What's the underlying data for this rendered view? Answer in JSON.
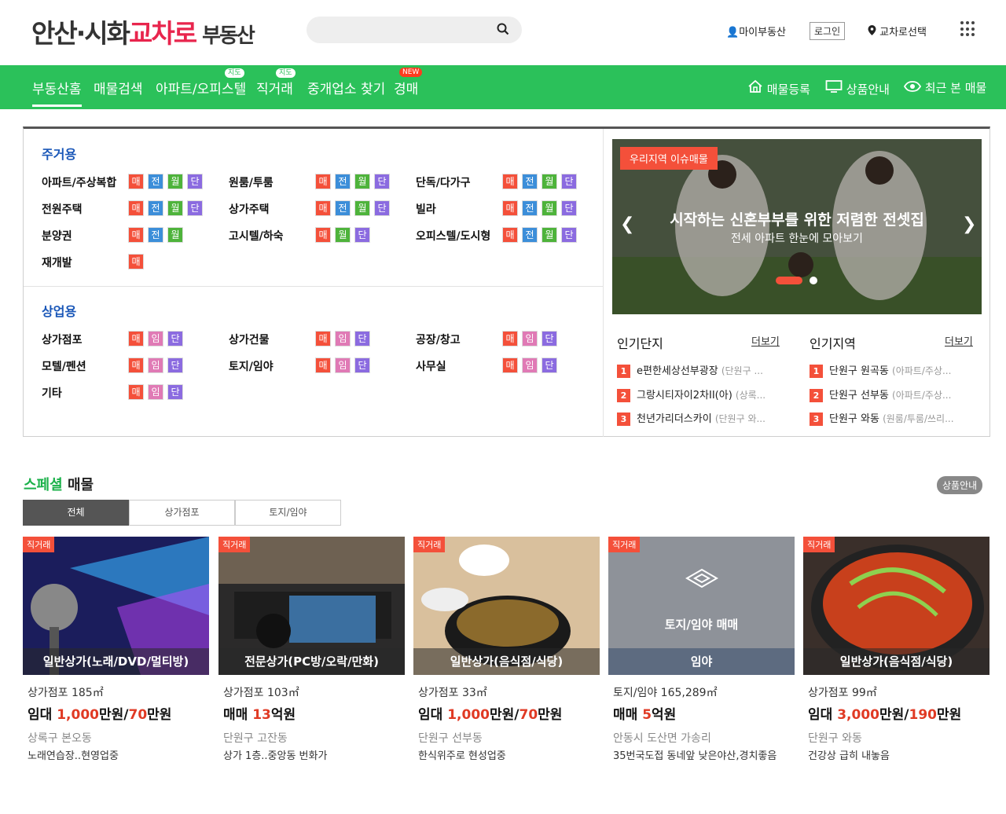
{
  "header": {
    "logo": {
      "part1": "안산·시화",
      "part2": "교차로",
      "part3": "부동산"
    },
    "my_link": "마이부동산",
    "login": "로그인",
    "region_select": "교차로선택"
  },
  "nav": {
    "items": [
      {
        "label": "부동산홈"
      },
      {
        "label": "매물검색"
      },
      {
        "label": "아파트/오피스텔",
        "tag": "지도"
      },
      {
        "label": "직거래",
        "tag": "지도"
      },
      {
        "label": "중개업소 찾기"
      },
      {
        "label": "경매",
        "tag": "NEW"
      }
    ],
    "right": [
      "매물등록",
      "상품안내",
      "최근 본 매물"
    ]
  },
  "categories": {
    "residential_title": "주거용",
    "residential": [
      {
        "name": "아파트/주상복합",
        "tags": [
          "매",
          "전",
          "월",
          "단"
        ]
      },
      {
        "name": "원룸/투룸",
        "tags": [
          "매",
          "전",
          "월",
          "단"
        ]
      },
      {
        "name": "단독/다가구",
        "tags": [
          "매",
          "전",
          "월",
          "단"
        ]
      },
      {
        "name": "전원주택",
        "tags": [
          "매",
          "전",
          "월",
          "단"
        ]
      },
      {
        "name": "상가주택",
        "tags": [
          "매",
          "전",
          "월",
          "단"
        ]
      },
      {
        "name": "빌라",
        "tags": [
          "매",
          "전",
          "월",
          "단"
        ]
      },
      {
        "name": "분양권",
        "tags": [
          "매",
          "전",
          "월"
        ]
      },
      {
        "name": "고시텔/하숙",
        "tags": [
          "매",
          "월",
          "단"
        ]
      },
      {
        "name": "오피스텔/도시형",
        "tags": [
          "매",
          "전",
          "월",
          "단"
        ]
      },
      {
        "name": "재개발",
        "tags": [
          "매"
        ]
      }
    ],
    "commercial_title": "상업용",
    "commercial": [
      {
        "name": "상가점포",
        "tags": [
          "매",
          "임",
          "단"
        ]
      },
      {
        "name": "상가건물",
        "tags": [
          "매",
          "임",
          "단"
        ]
      },
      {
        "name": "공장/창고",
        "tags": [
          "매",
          "임",
          "단"
        ]
      },
      {
        "name": "모텔/펜션",
        "tags": [
          "매",
          "임",
          "단"
        ]
      },
      {
        "name": "토지/임야",
        "tags": [
          "매",
          "임",
          "단"
        ]
      },
      {
        "name": "사무실",
        "tags": [
          "매",
          "임",
          "단"
        ]
      },
      {
        "name": "기타",
        "tags": [
          "매",
          "임",
          "단"
        ]
      }
    ]
  },
  "banner": {
    "tag": "우리지역 이슈매물",
    "title": "시작하는 신혼부부를 위한 저렴한 전셋집",
    "subtitle": "전세 아파트 한눈에 모아보기"
  },
  "rankings": {
    "complex_title": "인기단지",
    "region_title": "인기지역",
    "more": "더보기",
    "complex": [
      {
        "rank": "1",
        "name": "e편한세상선부광장",
        "sub": "(단원구 ..."
      },
      {
        "rank": "2",
        "name": "그랑시티자이2차II(아)",
        "sub": "(상록..."
      },
      {
        "rank": "3",
        "name": "천년가리더스카이",
        "sub": "(단원구 와..."
      }
    ],
    "region": [
      {
        "rank": "1",
        "name": "단원구 원곡동",
        "sub": "(아파트/주상..."
      },
      {
        "rank": "2",
        "name": "단원구 선부동",
        "sub": "(아파트/주상..."
      },
      {
        "rank": "3",
        "name": "단원구 와동",
        "sub": "(원룸/투룸/쓰리..."
      }
    ]
  },
  "special": {
    "title_green": "스페셜",
    "title_rest": "매물",
    "guide_btn": "상품안내",
    "tabs": [
      "전체",
      "상가점포",
      "토지/임야"
    ],
    "cards": [
      {
        "badge": "직거래",
        "caption": "일반상가(노래/DVD/멀티방)",
        "line1": "상가점포 185㎡",
        "price_pre": "임대 ",
        "p1": "1,000",
        "p1u": "만원/",
        "p2": "70",
        "p2u": "만원",
        "location": "상록구 본오동",
        "desc": "노래연습장..현영업중"
      },
      {
        "badge": "직거래",
        "caption": "전문상가(PC방/오락/만화)",
        "line1": "상가점포 103㎡",
        "price_pre": "매매 ",
        "p1": "13",
        "p1u": "억원",
        "p2": "",
        "p2u": "",
        "location": "단원구 고잔동",
        "desc": "상가 1층..중앙동 번화가"
      },
      {
        "badge": "직거래",
        "caption": "일반상가(음식점/식당)",
        "line1": "상가점포 33㎡",
        "price_pre": "임대 ",
        "p1": "1,000",
        "p1u": "만원/",
        "p2": "70",
        "p2u": "만원",
        "location": "단원구 선부동",
        "desc": "한식위주로 현성업중"
      },
      {
        "badge": "직거래",
        "caption": "임야",
        "placeholder": "토지/임야 매매",
        "line1": "토지/임야 165,289㎡",
        "price_pre": "매매 ",
        "p1": "5",
        "p1u": "억원",
        "p2": "",
        "p2u": "",
        "location": "안동시 도산면 가송리",
        "desc": "35번국도접 동네앞 낮은야산,경치좋음"
      },
      {
        "badge": "직거래",
        "caption": "일반상가(음식점/식당)",
        "line1": "상가점포 99㎡",
        "price_pre": "임대 ",
        "p1": "3,000",
        "p1u": "만원/",
        "p2": "190",
        "p2u": "만원",
        "location": "단원구 와동",
        "desc": "건강상 급히 내놓음"
      }
    ]
  }
}
